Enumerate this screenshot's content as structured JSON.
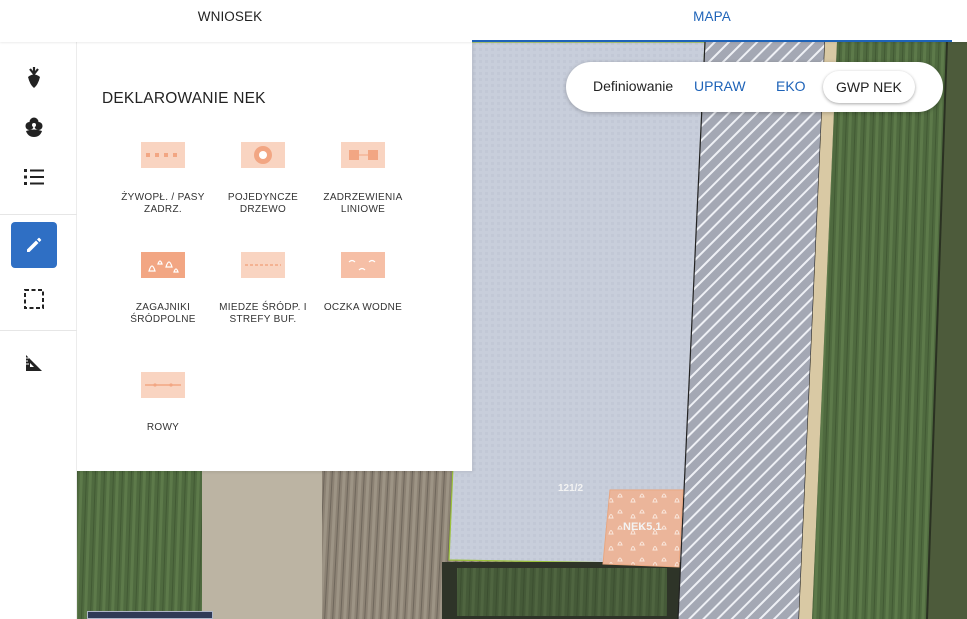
{
  "tabs": {
    "wniosek": "WNIOSEK",
    "mapa": "MAPA"
  },
  "rail": {
    "items": [
      {
        "icon": "beet-icon"
      },
      {
        "icon": "flower-icon"
      },
      {
        "icon": "list-icon"
      },
      {
        "icon": "pencil-icon",
        "active": true
      },
      {
        "icon": "select-area-icon"
      },
      {
        "icon": "ruler-triangle-icon"
      }
    ]
  },
  "panel": {
    "title": "DEKLAROWANIE NEK",
    "items": [
      {
        "label": "ŻYWOPŁ. / PASY ZADRZ.",
        "icon": "hedgerow-icon"
      },
      {
        "label": "POJEDYNCZE DRZEWO",
        "icon": "single-tree-icon"
      },
      {
        "label": "ZADRZEWIENIA LINIOWE",
        "icon": "tree-line-icon"
      },
      {
        "label": "ZAGAJNIKI ŚRÓDPOLNE",
        "icon": "grove-icon"
      },
      {
        "label": "MIEDZE ŚRÓDP. I STREFY BUF.",
        "icon": "balk-icon"
      },
      {
        "label": "OCZKA WODNE",
        "icon": "pond-icon"
      },
      {
        "label": "ROWY",
        "icon": "ditch-icon"
      }
    ]
  },
  "toggle": {
    "label": "Definiowanie",
    "options": [
      "UPRAW",
      "EKO",
      "GWP NEK"
    ],
    "selected": "GWP NEK"
  },
  "map": {
    "parcel_label": "121/2",
    "nek_label": "NEK5.1"
  },
  "colors": {
    "accent": "#1e63b8",
    "nek_fill": "#f2b99a"
  }
}
